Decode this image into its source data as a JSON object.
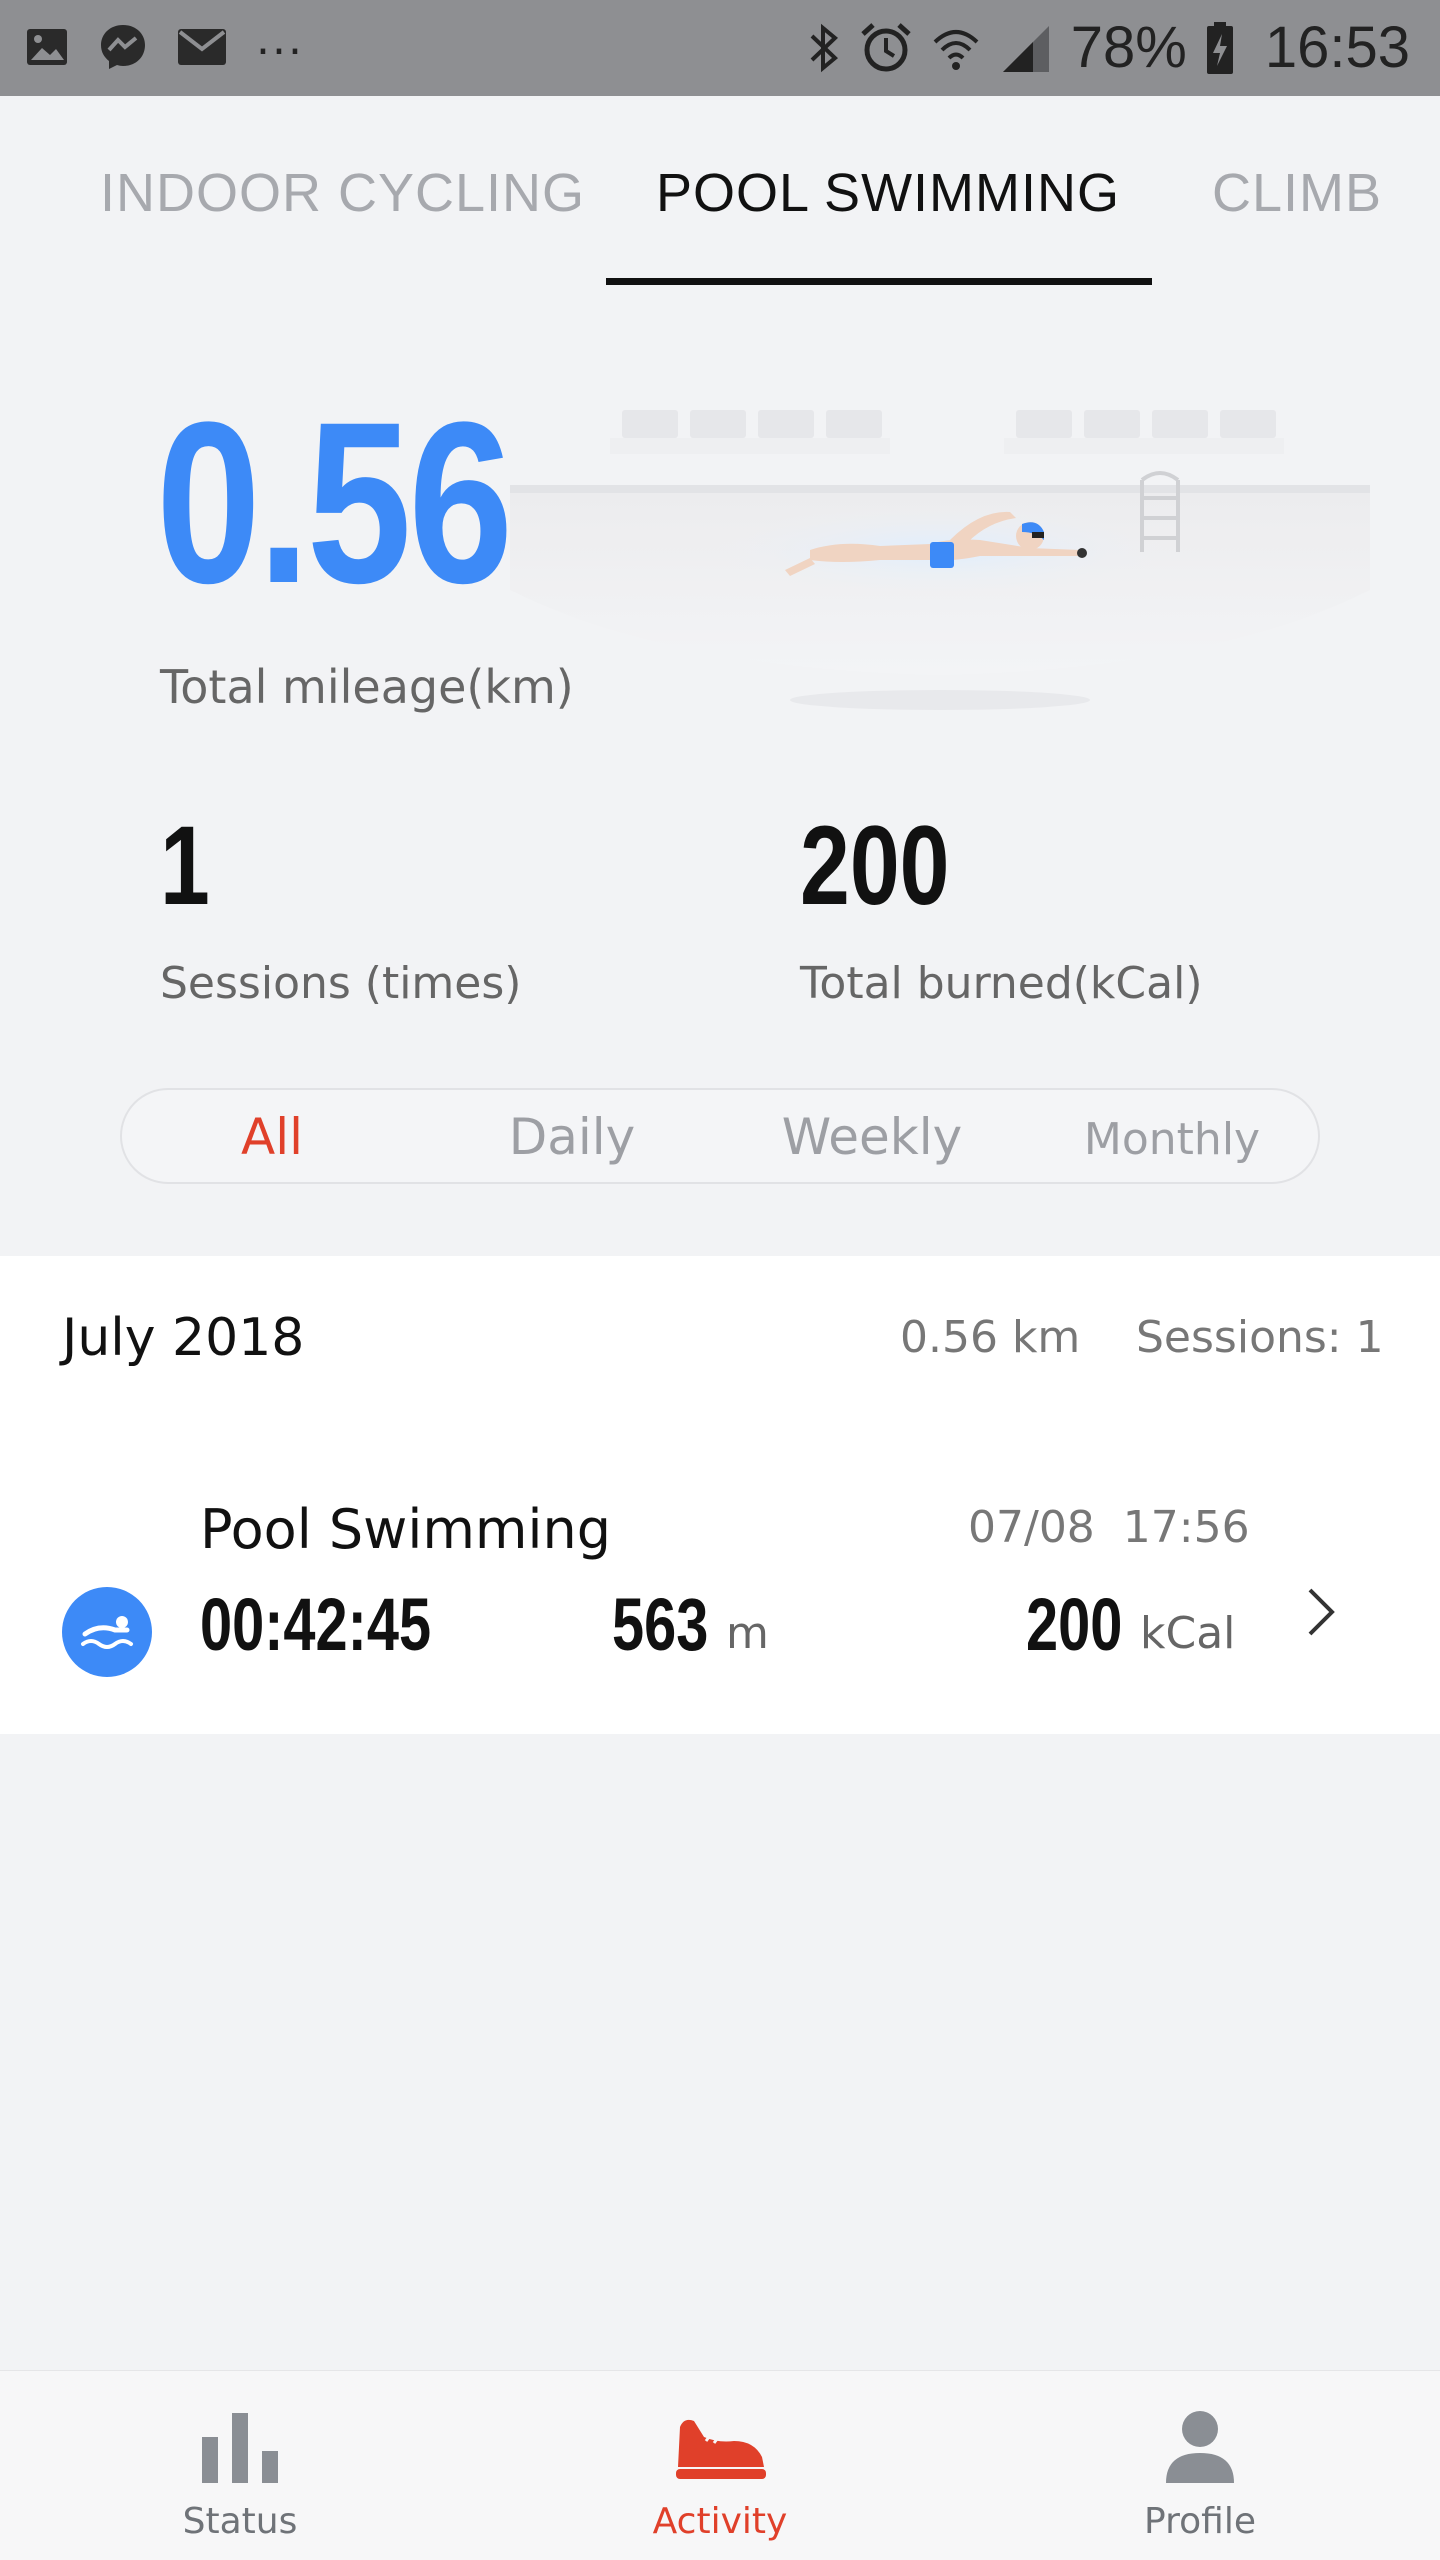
{
  "status_bar": {
    "battery": "78%",
    "time": "16:53",
    "more": "..."
  },
  "tabs": [
    {
      "label": "INDOOR CYCLING",
      "active": false
    },
    {
      "label": "POOL SWIMMING",
      "active": true
    },
    {
      "label": "CLIMB",
      "active": false
    }
  ],
  "hero": {
    "value": "0.56",
    "label": "Total mileage(km)"
  },
  "stats": [
    {
      "value": "1",
      "label": "Sessions (times)"
    },
    {
      "value": "200",
      "label": "Total burned(kCal)"
    }
  ],
  "filter": {
    "options": [
      "All",
      "Daily",
      "Weekly",
      "Monthly"
    ],
    "selected": "All"
  },
  "summary": {
    "month": "July 2018",
    "distance": "0.56 km",
    "sessions": "Sessions: 1"
  },
  "activity": {
    "title": "Pool Swimming",
    "datetime": "07/08  17:56",
    "duration": "00:42:45",
    "distance_value": "563",
    "distance_unit": "m",
    "calories_value": "200",
    "calories_unit": "kCal"
  },
  "bottom_nav": [
    {
      "label": "Status",
      "icon": "bar-chart-icon",
      "active": false
    },
    {
      "label": "Activity",
      "icon": "shoe-icon",
      "active": true
    },
    {
      "label": "Profile",
      "icon": "person-icon",
      "active": false
    }
  ],
  "colors": {
    "accent_blue": "#3d8af7",
    "accent_red": "#e0402a",
    "background": "#f2f3f5"
  }
}
